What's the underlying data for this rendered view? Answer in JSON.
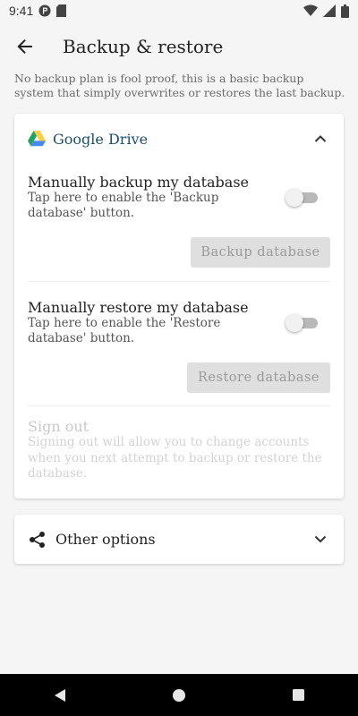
{
  "status_bar": {
    "time": "9:41"
  },
  "app_bar": {
    "title": "Backup & restore"
  },
  "notice": "No backup plan is fool proof, this is a basic backup system that simply overwrites or restores the last backup.",
  "google_drive": {
    "title": "Google Drive",
    "backup": {
      "title": "Manually backup my database",
      "subtitle": "Tap here to enable the 'Backup database' button.",
      "enabled": false,
      "button": "Backup database"
    },
    "restore": {
      "title": "Manually restore my database",
      "subtitle": "Tap here to enable the 'Restore database' button.",
      "enabled": false,
      "button": "Restore database"
    },
    "sign_out": {
      "title": "Sign out",
      "subtitle": "Signing out will allow you to change accounts when you next attempt to backup or restore the database."
    }
  },
  "other_options": {
    "label": "Other options"
  },
  "icons": {
    "back": "arrow-back-icon",
    "drive": "google-drive-icon",
    "collapse": "chevron-up-icon",
    "expand": "chevron-down-icon",
    "share": "share-icon",
    "nav_back": "triangle-back-icon",
    "nav_home": "circle-home-icon",
    "nav_recents": "square-recents-icon"
  },
  "colors": {
    "drive_title": "#1a4e6b",
    "disabled_button": "#dfdfdf",
    "navbar": "#000000"
  }
}
